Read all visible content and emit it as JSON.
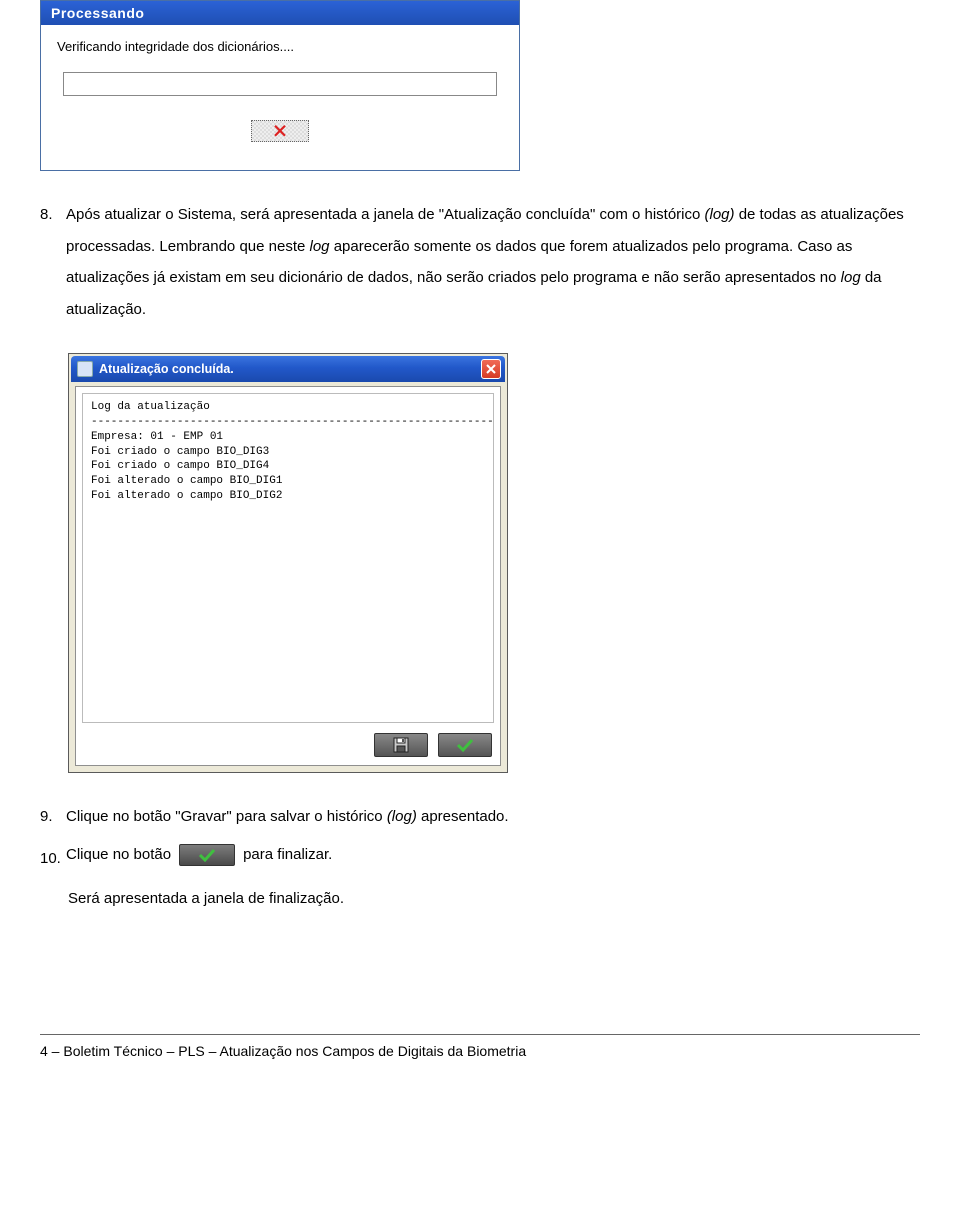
{
  "win1": {
    "title": "Processando",
    "status": "Verificando integridade dos dicionários...."
  },
  "step8": {
    "num": "8.",
    "text_parts": {
      "a": "Após atualizar o Sistema, será apresentada a janela de \"Atualização concluída\" com o histórico ",
      "b": "(log)",
      "c": " de todas as atualizações processadas. Lembrando que neste ",
      "d": "log",
      "e": " aparecerão somente os dados que forem atualizados pelo programa. Caso as atualizações já existam em seu dicionário de dados, não serão criados pelo programa e não serão apresentados no ",
      "f": "log",
      "g": " da atualização."
    }
  },
  "win2": {
    "title": "Atualização concluída.",
    "log_lines": [
      "Log da atualização",
      "------------------------------------------------------------------",
      "Empresa: 01 - EMP 01",
      "Foi criado o campo BIO_DIG3",
      "Foi criado o campo BIO_DIG4",
      "Foi alterado o campo BIO_DIG1",
      "Foi alterado o campo BIO_DIG2"
    ]
  },
  "step9": {
    "num": "9.",
    "text_parts": {
      "a": "Clique no botão \"Gravar\" para salvar o histórico ",
      "b": "(log)",
      "c": " apresentado."
    }
  },
  "step10": {
    "num": "10.",
    "text_a": "Clique no botão ",
    "text_b": " para finalizar."
  },
  "closing": "Será apresentada a janela de finalização.",
  "footer": "4 – Boletim Técnico – PLS – Atualização nos Campos de Digitais da Biometria"
}
